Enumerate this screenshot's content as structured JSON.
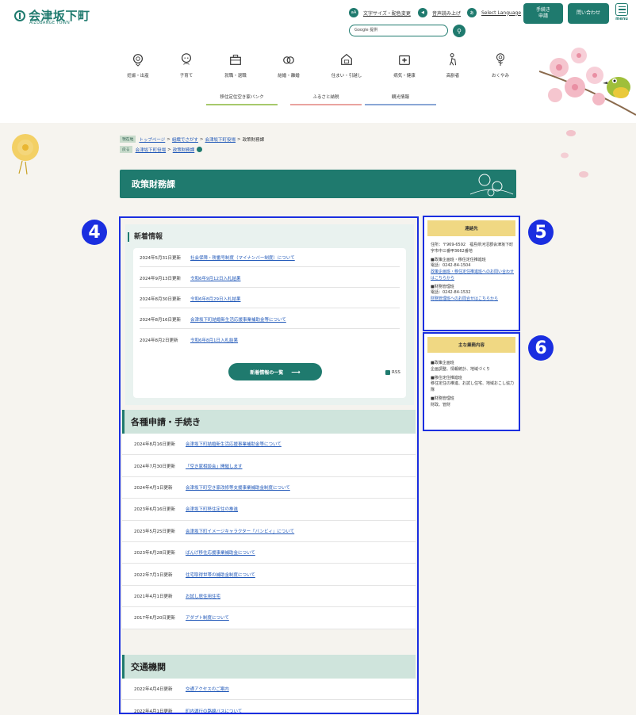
{
  "header": {
    "logo_text": "会津坂下町",
    "logo_sub": "AIZUBANGE TOWN",
    "util": {
      "font_size": "文字サイズ・配色変更",
      "read_aloud": "音声読み上げ",
      "language": "Select Language"
    },
    "search_placeholder": "Google 提供",
    "buttons": {
      "procedure": "手続き\n申請",
      "contact": "問い合わせ",
      "menu": "menu"
    }
  },
  "nav": [
    {
      "label": "妊娠・出産",
      "icon": "pregnancy-icon"
    },
    {
      "label": "子育て",
      "icon": "child-icon"
    },
    {
      "label": "就職・退職",
      "icon": "briefcase-icon"
    },
    {
      "label": "結婚・離婚",
      "icon": "rings-icon"
    },
    {
      "label": "住まい・引越し",
      "icon": "house-icon"
    },
    {
      "label": "病気・健康",
      "icon": "medical-icon"
    },
    {
      "label": "高齢者",
      "icon": "elderly-icon"
    },
    {
      "label": "おくやみ",
      "icon": "flower-icon"
    }
  ],
  "sub_links": [
    "移住定住空き家バンク",
    "ふるさと納税",
    "観光情報"
  ],
  "breadcrumb": {
    "current_tag": "現在地",
    "path": [
      "トップページ",
      "組織でさがす",
      "会津坂下町役場"
    ],
    "current": "政策財務課",
    "back_tag": "戻る",
    "back_path": [
      "会津坂下町役場",
      "政策財務課"
    ]
  },
  "page_title": "政策財務課",
  "news": {
    "heading": "新着情報",
    "items": [
      {
        "date": "2024年5月31日更新",
        "title": "社会保障・税番号制度（マイナンバー制度）について"
      },
      {
        "date": "2024年9月13日更新",
        "title": "令和6年9月12日入札結果"
      },
      {
        "date": "2024年8月30日更新",
        "title": "令和6年8月29日入札結果"
      },
      {
        "date": "2024年8月16日更新",
        "title": "会津坂下町結婚新生活応援事業補助金等について"
      },
      {
        "date": "2024年8月2日更新",
        "title": "令和6年8月1日入札結果"
      }
    ],
    "more_label": "新着情報の一覧",
    "rss_label": "RSS"
  },
  "procedures": {
    "heading": "各種申請・手続き",
    "items": [
      {
        "date": "2024年8月16日更新",
        "title": "会津坂下町結婚新生活応援事業補助金等について"
      },
      {
        "date": "2024年7月30日更新",
        "title": "「空き家相談会」開催します"
      },
      {
        "date": "2024年4月1日更新",
        "title": "会津坂下町空き家改修等支援事業補助金制度について"
      },
      {
        "date": "2023年6月16日更新",
        "title": "会津坂下町移住定住の推進"
      },
      {
        "date": "2023年5月25日更新",
        "title": "会津坂下町イメージキャラクター「バンビィ」について"
      },
      {
        "date": "2023年6月28日更新",
        "title": "ばんげ移住応援事業補助金について"
      },
      {
        "date": "2022年7月1日更新",
        "title": "住宅取得世帯の補助金制度について"
      },
      {
        "date": "2021年4月1日更新",
        "title": "お試し居住用住宅"
      },
      {
        "date": "2017年6月20日更新",
        "title": "アダプト制度について"
      }
    ]
  },
  "transport": {
    "heading": "交通機関",
    "items": [
      {
        "date": "2022年4月4日更新",
        "title": "交通アクセスのご案内"
      },
      {
        "date": "2022年4月1日更新",
        "title": "町内運行の路線バスについて"
      }
    ]
  },
  "contact": {
    "heading": "連絡先",
    "address": "住所：〒969-6592　福島県河沼郡会津坂下町字市中三番甲3662番地",
    "dept1_name": "■政策企画班・移住定住推進班",
    "dept1_tel": "電話：0242-84-1504",
    "dept1_link": "政策企画班・移住定住推進班へのお問い合わせはこちらから",
    "dept2_name": "■財務管理班",
    "dept2_tel": "電話：0242-84-1532",
    "dept2_link": "財務管理班へのお問合せはこちらから"
  },
  "duties": {
    "heading": "主な業務内容",
    "group1_name": "■政策企画班",
    "group1_desc": "企画調整、情報統計、地域づくり",
    "group2_name": "■移住定住推進班",
    "group2_desc": "移住定住の推進、お試し住宅、地域おこし協力隊",
    "group3_name": "■財務管理班",
    "group3_desc": "財政、管財"
  },
  "badges": [
    "4",
    "5",
    "6"
  ]
}
